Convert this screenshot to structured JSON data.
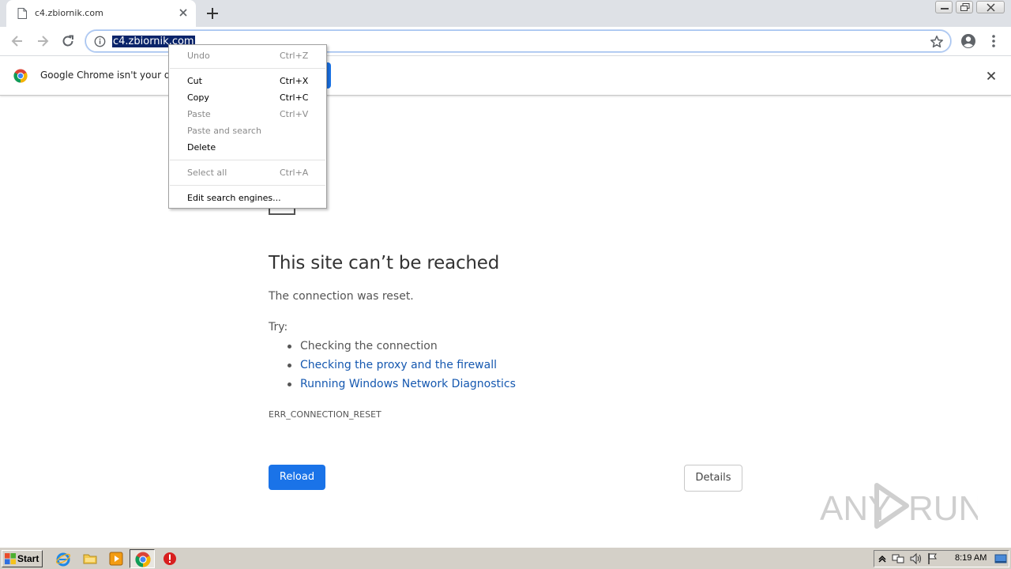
{
  "tab": {
    "title": "c4.zbiornik.com",
    "close_label": "×",
    "new_tab_label": "+"
  },
  "omnibox": {
    "url": "c4.zbiornik.com"
  },
  "infobar": {
    "message": "Google Chrome isn't your def"
  },
  "context_menu": {
    "items": [
      {
        "label": "Undo",
        "shortcut": "Ctrl+Z",
        "enabled": false
      },
      {
        "label": "Cut",
        "shortcut": "Ctrl+X",
        "enabled": true
      },
      {
        "label": "Copy",
        "shortcut": "Ctrl+C",
        "enabled": true
      },
      {
        "label": "Paste",
        "shortcut": "Ctrl+V",
        "enabled": false
      },
      {
        "label": "Paste and search",
        "shortcut": "",
        "enabled": false
      },
      {
        "label": "Delete",
        "shortcut": "",
        "enabled": true
      },
      {
        "label": "Select all",
        "shortcut": "Ctrl+A",
        "enabled": false
      },
      {
        "label": "Edit search engines...",
        "shortcut": "",
        "enabled": true
      }
    ]
  },
  "error_page": {
    "title": "This site can’t be reached",
    "subtitle": "The connection was reset.",
    "try_label": "Try:",
    "suggestions": [
      {
        "text": "Checking the connection",
        "is_link": false
      },
      {
        "text": "Checking the proxy and the firewall",
        "is_link": true
      },
      {
        "text": "Running Windows Network Diagnostics",
        "is_link": true
      }
    ],
    "error_code": "ERR_CONNECTION_RESET",
    "reload_label": "Reload",
    "details_label": "Details"
  },
  "watermark": {
    "text_left": "ANY",
    "text_right": "RUN"
  },
  "taskbar": {
    "start_label": "Start",
    "clock": "8:19 AM",
    "pinned_icons": [
      "internet-explorer-icon",
      "folder-icon",
      "media-player-icon",
      "chrome-icon",
      "stop-icon"
    ]
  },
  "colors": {
    "accent_blue": "#1a73e8",
    "link_blue": "#1558b0",
    "selection": "#0a246a",
    "taskbar": "#d4d0c8"
  }
}
